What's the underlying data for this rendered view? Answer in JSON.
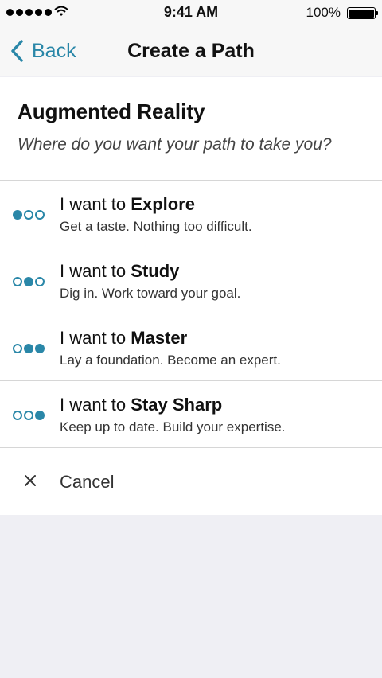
{
  "status_bar": {
    "time": "9:41 AM",
    "battery": "100%",
    "icons": [
      "signal-dots-icon",
      "wifi-icon",
      "battery-icon"
    ]
  },
  "nav": {
    "back_label": "Back",
    "title": "Create a Path",
    "accent_color": "#2a87a8"
  },
  "header": {
    "title": "Augmented Reality",
    "subtitle": "Where do you want your path to take you?"
  },
  "options": [
    {
      "prefix": "I want to ",
      "name": "Explore",
      "description": "Get a taste. Nothing too difficult.",
      "filled_dots": [
        true,
        false,
        false
      ]
    },
    {
      "prefix": "I want to ",
      "name": "Study",
      "description": "Dig in. Work toward your goal.",
      "filled_dots": [
        false,
        true,
        false
      ]
    },
    {
      "prefix": "I want to ",
      "name": "Master",
      "description": "Lay a foundation. Become an expert.",
      "filled_dots": [
        false,
        true,
        true
      ]
    },
    {
      "prefix": "I want to ",
      "name": "Stay Sharp",
      "description": "Keep up to date. Build your expertise.",
      "filled_dots": [
        false,
        false,
        true
      ]
    }
  ],
  "cancel_label": "Cancel",
  "colors": {
    "accent": "#2a87a8",
    "background": "#efeff4",
    "separator": "#d6d6d6"
  }
}
